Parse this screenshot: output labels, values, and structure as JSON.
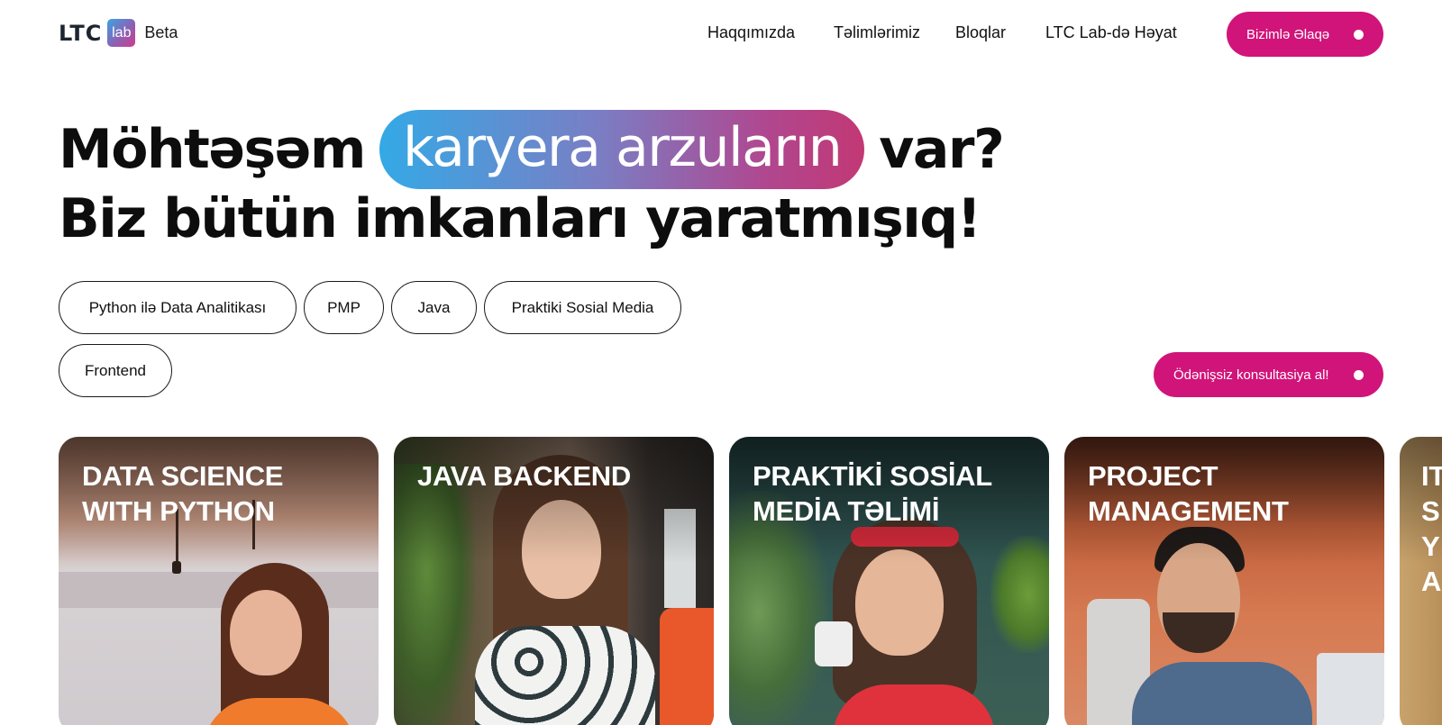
{
  "header": {
    "logo_main": "LTC",
    "logo_badge": "lab",
    "logo_suffix": "Beta",
    "nav": [
      "Haqqımızda",
      "Təlimlərimiz",
      "Bloqlar",
      "LTC Lab-də Həyat"
    ],
    "contact_label": "Bizimlə Əlaqə"
  },
  "hero": {
    "line1_before": "Möhtəşəm",
    "line1_highlight": "karyera arzuların",
    "line1_after": "var?",
    "line2": "Biz bütün imkanları yaratmışıq!"
  },
  "tags": [
    "Python ilə Data Analitikası",
    "PMP",
    "Java",
    "Praktiki Sosial Media",
    "Frontend"
  ],
  "consult_label": "Ödənişsiz konsultasiya al!",
  "cards": [
    {
      "title": "DATA SCIENCE WITH PYTHON"
    },
    {
      "title": "JAVA BACKEND"
    },
    {
      "title": "PRAKTİKİ SOSİAL MEDİA TƏLİMİ"
    },
    {
      "title": "PROJECT MANAGEMENT"
    },
    {
      "title": "IT SY A"
    }
  ],
  "colors": {
    "accent": "#d1147a",
    "gradient_start": "#34a9e6",
    "gradient_end": "#c23874",
    "text": "#111111"
  },
  "icons": {
    "button_dot": "dot-icon"
  }
}
